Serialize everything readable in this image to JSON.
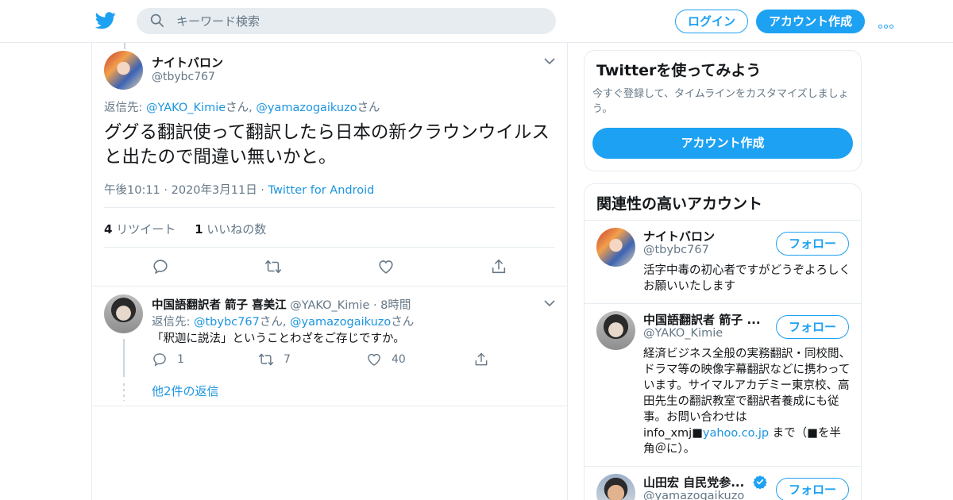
{
  "header": {
    "search_placeholder": "キーワード検索",
    "login_label": "ログイン",
    "signup_label": "アカウント作成",
    "brand_color": "#1da1f2"
  },
  "main_tweet": {
    "name": "ナイトバロン",
    "handle": "@tbybc767",
    "reply_prefix": "返信先:",
    "reply_to_1": "@YAKO_Kimie",
    "reply_to_1_suffix": "さん,",
    "reply_to_2": "@yamazogaikuzo",
    "reply_to_2_suffix": "さん",
    "text": "ググる翻訳使って翻訳したら日本の新クラウンウイルスと出たので間違い無いかと。",
    "timestamp": "午後10:11 · 2020年3月11日",
    "separator": " · ",
    "source": "Twitter for Android",
    "retweet_count": "4",
    "retweet_label": "リツイート",
    "like_count": "1",
    "like_label": "いいねの数"
  },
  "reply_tweet": {
    "name": "中国語翻訳者 箭子 喜美江",
    "handle": "@YAKO_Kimie",
    "time": "· 8時間",
    "reply_prefix": "返信先:",
    "reply_to_1": "@tbybc767",
    "reply_to_1_suffix": "さん,",
    "reply_to_2": "@yamazogaikuzo",
    "reply_to_2_suffix": "さん",
    "text": "「釈迦に説法」ということわざをご存じですか。",
    "reply_count": "1",
    "retweet_count": "7",
    "like_count": "40",
    "more_replies": "他2件の返信"
  },
  "sidebar": {
    "signup_card": {
      "title": "Twitterを使ってみよう",
      "description": "今すぐ登録して、タイムラインをカスタマイズしましょう。",
      "button": "アカウント作成"
    },
    "relevant": {
      "title": "関連性の高いアカウント",
      "follow_label": "フォロー",
      "accounts": [
        {
          "name": "ナイトバロン",
          "handle": "@tbybc767",
          "bio": "活字中毒の初心者ですがどうぞよろしくお願いいたします"
        },
        {
          "name": "中国語翻訳者 箭子 ...",
          "handle": "@YAKO_Kimie",
          "bio": "経済ビジネス全般の実務翻訳・同校閲、ドラマ等の映像字幕翻訳などに携わっています。サイマルアカデミー東京校、高田先生の翻訳教室で翻訳者養成にも従事。お問い合わせは info_xmj■",
          "bio_link": "yahoo.co.jp",
          "bio_tail": " まで（■を半角＠に）。"
        },
        {
          "name": "山田宏 自民党参...",
          "handle": "@yamazogaikuzo"
        }
      ]
    }
  }
}
